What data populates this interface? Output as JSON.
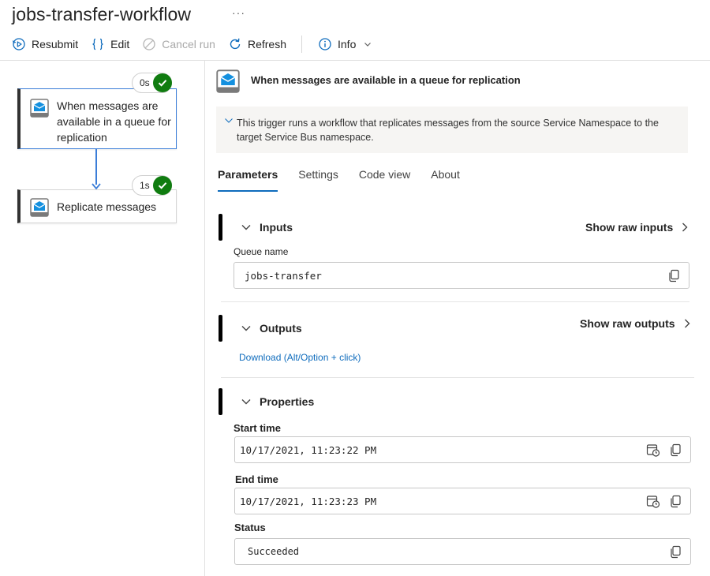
{
  "header": {
    "title": "jobs-transfer-workflow",
    "more": "···"
  },
  "toolbar": {
    "resubmit": "Resubmit",
    "edit": "Edit",
    "cancel_run": "Cancel run",
    "refresh": "Refresh",
    "info": "Info"
  },
  "canvas": {
    "trigger": {
      "label": "When messages are available in a queue for replication",
      "duration": "0s"
    },
    "action": {
      "label": "Replicate messages",
      "duration": "1s"
    }
  },
  "panel": {
    "title": "When messages are available in a queue for replication",
    "description": "This trigger runs a workflow that replicates messages from the source Service Namespace to the target Service Bus namespace.",
    "tabs": [
      "Parameters",
      "Settings",
      "Code view",
      "About"
    ],
    "inputs": {
      "heading": "Inputs",
      "raw_link": "Show raw inputs",
      "queue_label": "Queue name",
      "queue_value": "jobs-transfer"
    },
    "outputs": {
      "heading": "Outputs",
      "raw_link": "Show raw outputs",
      "download": "Download (Alt/Option + click)"
    },
    "properties": {
      "heading": "Properties",
      "start_label": "Start time",
      "start_value": "10/17/2021, 11:23:22 PM",
      "end_label": "End time",
      "end_value": "10/17/2021, 11:23:23 PM",
      "status_label": "Status",
      "status_value": "Succeeded"
    }
  },
  "colors": {
    "accent": "#0f6cbd",
    "success": "#107c10",
    "connector": "#3b7dd8",
    "disabled": "#a8a8a8"
  }
}
